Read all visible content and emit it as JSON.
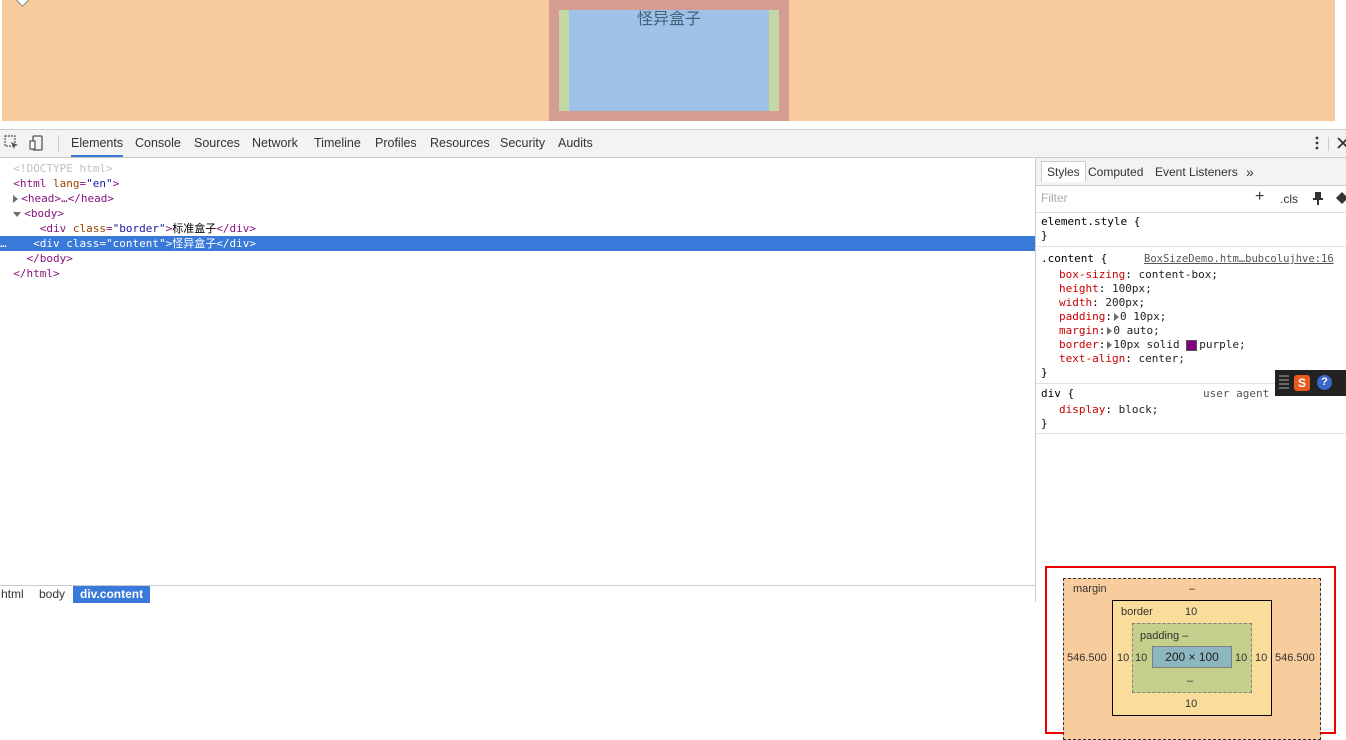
{
  "page": {
    "content_text": "怪异盒子"
  },
  "toolbar": {
    "tabs": [
      "Elements",
      "Console",
      "Sources",
      "Network",
      "Timeline",
      "Profiles",
      "Resources",
      "Security",
      "Audits"
    ]
  },
  "elements": {
    "doctype": "<!DOCTYPE html>",
    "html_open": "<html",
    "lang_attr": "lang",
    "lang_val": "\"en\"",
    "head": "<head>…</head>",
    "body_open": "<body>",
    "div1_attr_val": "\"border\"",
    "div1_text": "标准盒子",
    "div2_attr_val": "\"content\"",
    "div2_text": "怪异盒子",
    "body_close": "</body>",
    "html_close": "</html>",
    "dots": "…"
  },
  "breadcrumbs": [
    "html",
    "body",
    "div.content"
  ],
  "sidebar": {
    "tabs": [
      "Styles",
      "Computed",
      "Event Listeners"
    ],
    "more": "»",
    "filter_placeholder": "Filter",
    "plus": "+",
    "cls": ".cls",
    "element_style": "element.style {",
    "close_brace": "}",
    "content_selector": ".content {",
    "source_link": "BoxSizeDemo.htm…bubcolujhve:16",
    "props": [
      {
        "name": "box-sizing",
        "value": "content-box;"
      },
      {
        "name": "height",
        "value": "100px;"
      },
      {
        "name": "width",
        "value": "200px;"
      },
      {
        "name": "padding",
        "value": "0 10px;"
      },
      {
        "name": "margin",
        "value": "0 auto;"
      },
      {
        "name": "border",
        "value": "10px solid "
      },
      {
        "name": "text-align",
        "value": "center;"
      }
    ],
    "border_color_name": "purple;",
    "div_selector": "div {",
    "user_agent": "user agent",
    "display_prop": "display",
    "display_val": "block;"
  },
  "box_model": {
    "margin_label": "margin",
    "margin_top": "–",
    "margin_left": "546.500",
    "margin_right": "546.500",
    "border_label": "border",
    "border_top": "10",
    "border_left": "10",
    "border_right": "10",
    "border_bottom": "10",
    "padding_label": "padding –",
    "padding_left": "10",
    "padding_right": "10",
    "padding_bottom": "–",
    "content": "200 × 100"
  },
  "ime": {
    "s": "S",
    "q": "?"
  }
}
